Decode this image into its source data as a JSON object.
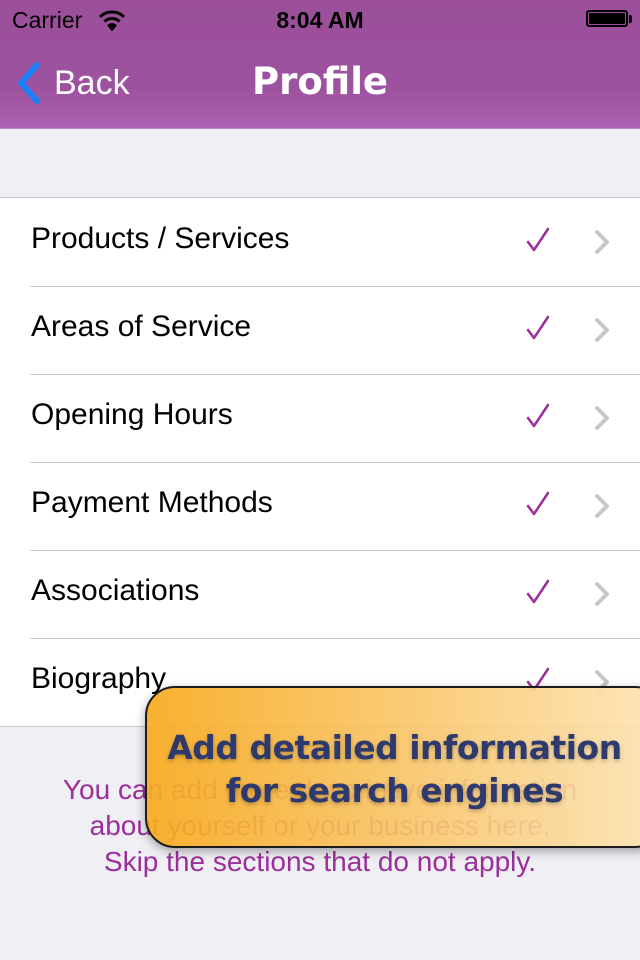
{
  "status_bar": {
    "carrier": "Carrier",
    "time": "8:04 AM",
    "wifi_icon": "wifi-icon",
    "battery_icon": "battery-full-icon"
  },
  "nav": {
    "back_label": "Back",
    "back_icon": "chevron-left-icon",
    "title": "Profile",
    "bar_color": "#9d52a0",
    "back_icon_color": "#1b7ff7"
  },
  "rows": [
    {
      "label": "Products / Services",
      "checked": true
    },
    {
      "label": "Areas of Service",
      "checked": true
    },
    {
      "label": "Opening Hours",
      "checked": true
    },
    {
      "label": "Payment Methods",
      "checked": true
    },
    {
      "label": "Associations",
      "checked": true
    },
    {
      "label": "Biography",
      "checked": true
    }
  ],
  "row_icons": {
    "check": "checkmark-icon",
    "disclosure": "chevron-right-icon",
    "check_color": "#9b2f9b",
    "disclosure_color": "#c7c7cc"
  },
  "footer": {
    "lines": [
      "You can add more descriptive information",
      "about yourself or your business here.",
      "Skip the sections that do not apply."
    ],
    "color": "#9b2f9b"
  },
  "callout": {
    "lines": [
      "Add detailed information",
      "for search engines"
    ],
    "text_color": "#2e3a6e"
  }
}
